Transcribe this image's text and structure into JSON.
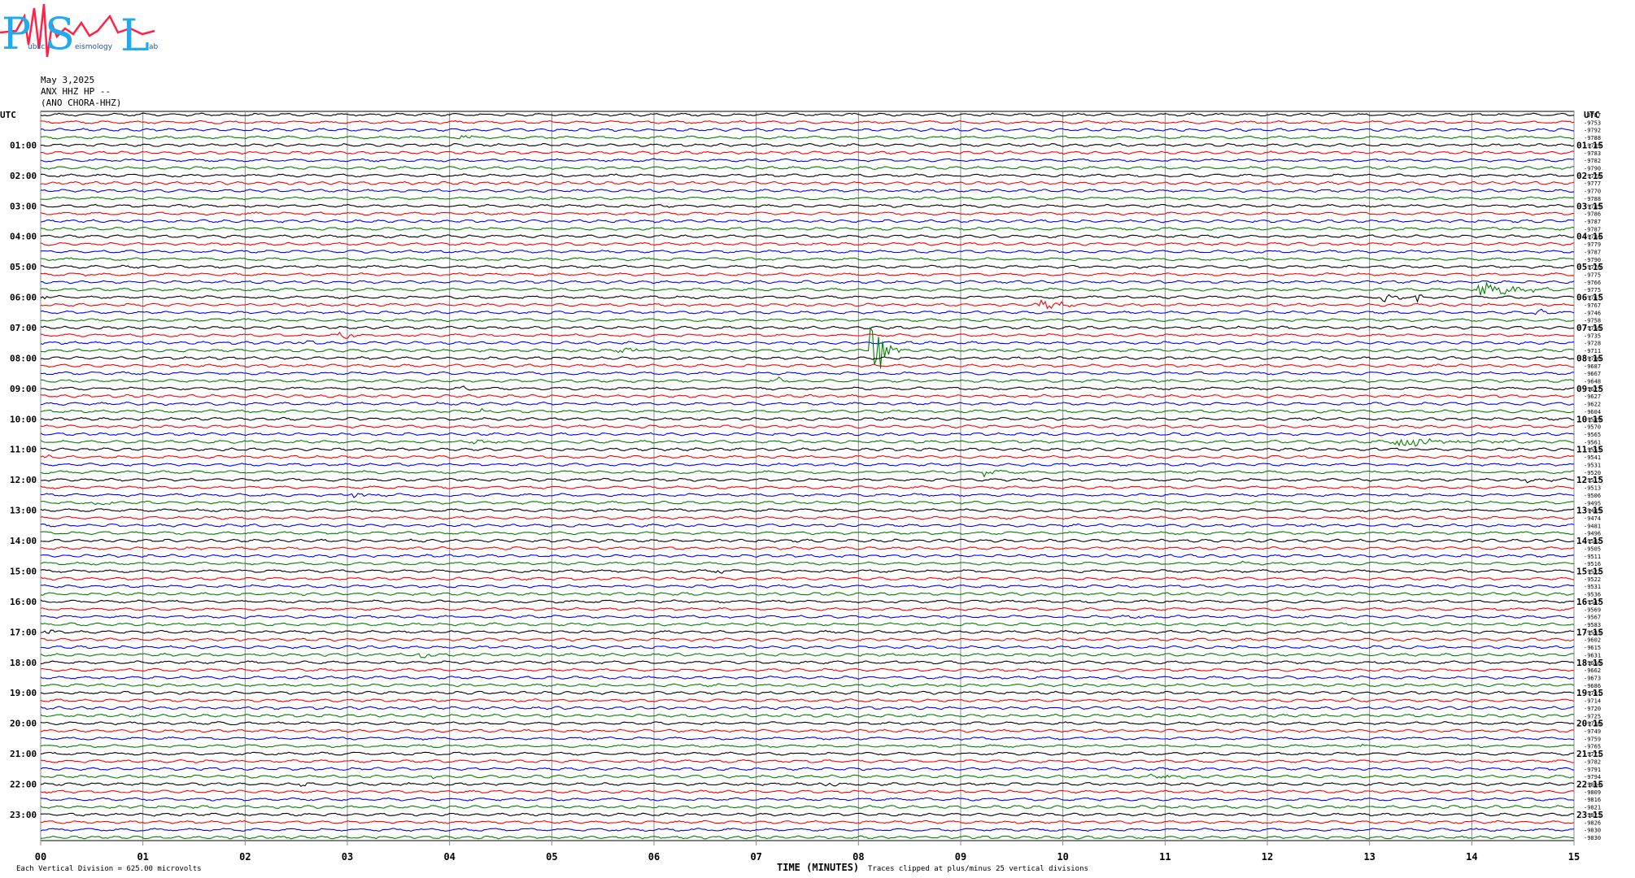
{
  "logo": {
    "letters": [
      "P",
      "S",
      "L"
    ],
    "subtext": [
      "ublic",
      "eismology",
      "ab"
    ]
  },
  "header": {
    "date": "May 3,2025",
    "station": "ANX HHZ HP --",
    "name": "(ANO CHORA-HHZ)"
  },
  "colors": {
    "trace_cycle": [
      "#000000",
      "#ff0000",
      "#0000ff",
      "#008000"
    ],
    "grid": "#888888",
    "logo_cyan": "#22aaee",
    "logo_red": "#ff2244"
  },
  "footer": {
    "vertical_division": "Each Vertical Division =  625.00 microvolts",
    "clip_note": "Traces clipped at plus/minus 25 vertical divisions"
  },
  "chart_data": {
    "type": "line",
    "title": "",
    "xlabel": "TIME (MINUTES)",
    "xlim": [
      0,
      15
    ],
    "x_ticks": [
      "00",
      "01",
      "02",
      "03",
      "04",
      "05",
      "06",
      "07",
      "08",
      "09",
      "10",
      "11",
      "12",
      "13",
      "14",
      "15"
    ],
    "left_axis_title": "UTC",
    "right_axis_title": "UTC",
    "left_row_labels": [
      "01:00",
      "02:00",
      "03:00",
      "04:00",
      "05:00",
      "06:00",
      "07:00",
      "08:00",
      "09:00",
      "10:00",
      "11:00",
      "12:00",
      "13:00",
      "14:00",
      "15:00",
      "16:00",
      "17:00",
      "18:00",
      "19:00",
      "20:00",
      "21:00",
      "22:00",
      "23:00"
    ],
    "right_row_labels": [
      "01:15",
      "02:15",
      "03:15",
      "04:15",
      "05:15",
      "06:15",
      "07:15",
      "08:15",
      "09:15",
      "10:15",
      "11:15",
      "12:15",
      "13:15",
      "14:15",
      "15:15",
      "16:15",
      "17:15",
      "18:15",
      "19:15",
      "20:15",
      "21:15",
      "22:15",
      "23:15"
    ],
    "rows_per_hour": 4,
    "trace_count": 96,
    "trace_offsets": [
      "-9787",
      "-9753",
      "-9792",
      "-9788",
      "-9789",
      "-9783",
      "-9782",
      "-9790",
      "-9778",
      "-9777",
      "-9770",
      "-9788",
      "-9785",
      "-9786",
      "-9787",
      "-9787",
      "-9784",
      "-9779",
      "-9787",
      "-9790",
      "-9776",
      "-9775",
      "-9766",
      "-9775",
      "-9767",
      "-9767",
      "-9746",
      "-9758",
      "-9750",
      "-9735",
      "-9728",
      "-9711",
      "-9700",
      "-9687",
      "-9667",
      "-9648",
      "-9627",
      "-9627",
      "-9622",
      "-9604",
      "-9589",
      "-9570",
      "-9565",
      "-9561",
      "-9553",
      "-9541",
      "-9531",
      "-9520",
      "-9517",
      "-9513",
      "-9506",
      "-9495",
      "-9485",
      "-9474",
      "-9481",
      "-9496",
      "-9502",
      "-9505",
      "-9511",
      "-9516",
      "-9522",
      "-9522",
      "-9531",
      "-9536",
      "-9547",
      "-9569",
      "-9567",
      "-9583",
      "-9593",
      "-9602",
      "-9615",
      "-9631",
      "-9650",
      "-9662",
      "-9673",
      "-9686",
      "-9701",
      "-9714",
      "-9720",
      "-9725",
      "-9738",
      "-9749",
      "-9759",
      "-9765",
      "-9771",
      "-9782",
      "-9791",
      "-9794",
      "-9804",
      "-9809",
      "-9816",
      "-9821",
      "-9823",
      "-9826",
      "-9830",
      "-9830"
    ],
    "events": [
      {
        "row": 3,
        "minute": 4.1,
        "duration": 0.2,
        "amp": 4
      },
      {
        "row": 8,
        "minute": 5.6,
        "duration": 0.3,
        "amp": 2
      },
      {
        "row": 21,
        "minute": 0.4,
        "duration": 0.3,
        "amp": 2
      },
      {
        "row": 23,
        "minute": 14.0,
        "duration": 1.0,
        "amp": 9
      },
      {
        "row": 24,
        "minute": 0.0,
        "duration": 0.3,
        "amp": 3
      },
      {
        "row": 24,
        "minute": 13.1,
        "duration": 0.4,
        "amp": 7
      },
      {
        "row": 24,
        "minute": 13.45,
        "duration": 0.1,
        "amp": 9
      },
      {
        "row": 25,
        "minute": 9.75,
        "duration": 0.5,
        "amp": 10
      },
      {
        "row": 26,
        "minute": 14.6,
        "duration": 0.3,
        "amp": 5
      },
      {
        "row": 29,
        "minute": 2.9,
        "duration": 0.3,
        "amp": 6
      },
      {
        "row": 30,
        "minute": 2.5,
        "duration": 0.3,
        "amp": 4
      },
      {
        "row": 31,
        "minute": 5.6,
        "duration": 0.9,
        "amp": 3
      },
      {
        "row": 31,
        "minute": 8.1,
        "duration": 0.3,
        "amp": 60
      },
      {
        "row": 35,
        "minute": 7.2,
        "duration": 0.15,
        "amp": 4
      },
      {
        "row": 35,
        "minute": 12.3,
        "duration": 0.2,
        "amp": 4
      },
      {
        "row": 36,
        "minute": 4.1,
        "duration": 0.2,
        "amp": 4
      },
      {
        "row": 39,
        "minute": 4.3,
        "duration": 0.1,
        "amp": 3
      },
      {
        "row": 43,
        "minute": 4.2,
        "duration": 0.5,
        "amp": 3
      },
      {
        "row": 43,
        "minute": 13.2,
        "duration": 1.3,
        "amp": 7
      },
      {
        "row": 45,
        "minute": 0.0,
        "duration": 0.2,
        "amp": 3
      },
      {
        "row": 47,
        "minute": 9.2,
        "duration": 0.3,
        "amp": 5
      },
      {
        "row": 48,
        "minute": 14.5,
        "duration": 0.4,
        "amp": 3
      },
      {
        "row": 50,
        "minute": 3.0,
        "duration": 0.5,
        "amp": 4
      },
      {
        "row": 51,
        "minute": 0.5,
        "duration": 0.3,
        "amp": 4
      },
      {
        "row": 57,
        "minute": 1.3,
        "duration": 0.3,
        "amp": 3
      },
      {
        "row": 59,
        "minute": 11.7,
        "duration": 0.2,
        "amp": 3
      },
      {
        "row": 60,
        "minute": 6.6,
        "duration": 0.2,
        "amp": 3
      },
      {
        "row": 66,
        "minute": 10.6,
        "duration": 0.4,
        "amp": 2
      },
      {
        "row": 68,
        "minute": 0.0,
        "duration": 0.4,
        "amp": 3
      },
      {
        "row": 71,
        "minute": 3.7,
        "duration": 0.2,
        "amp": 8
      },
      {
        "row": 77,
        "minute": 12.8,
        "duration": 0.3,
        "amp": 2
      },
      {
        "row": 83,
        "minute": 12.9,
        "duration": 0.1,
        "amp": 3
      },
      {
        "row": 87,
        "minute": 3.8,
        "duration": 0.2,
        "amp": 4
      },
      {
        "row": 87,
        "minute": 10.8,
        "duration": 0.8,
        "amp": 2
      },
      {
        "row": 88,
        "minute": 2.5,
        "duration": 0.5,
        "amp": 2
      },
      {
        "row": 88,
        "minute": 7.6,
        "duration": 0.4,
        "amp": 3
      }
    ]
  }
}
